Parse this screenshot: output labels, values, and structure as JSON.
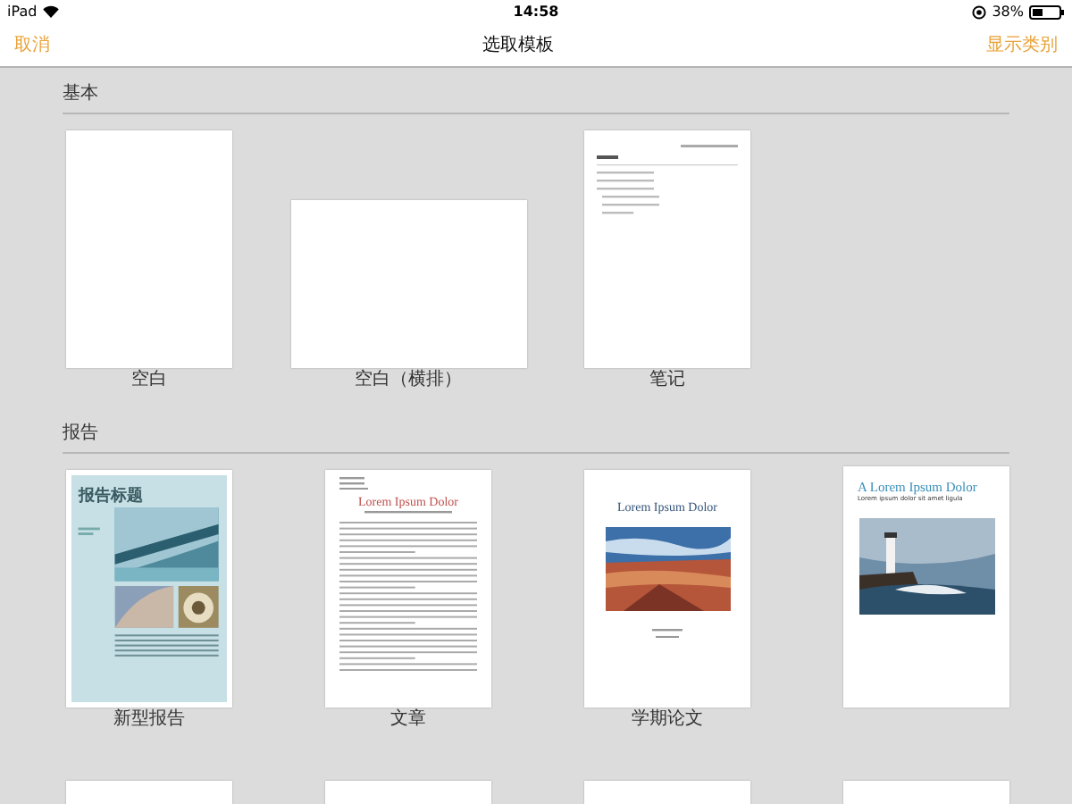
{
  "status_bar": {
    "device": "iPad",
    "time": "14:58",
    "battery": "38%"
  },
  "nav": {
    "cancel": "取消",
    "title": "选取模板",
    "show_categories": "显示类别"
  },
  "sections": [
    {
      "title": "基本",
      "templates": [
        {
          "kind": "blank",
          "name": "空白"
        },
        {
          "kind": "landscape",
          "name": "空白（横排）"
        },
        {
          "kind": "notes",
          "name": "笔记"
        }
      ]
    },
    {
      "title": "报告",
      "templates": [
        {
          "kind": "report",
          "name": "新型报告",
          "heading": "报告标题"
        },
        {
          "kind": "article",
          "name": "文章",
          "heading": "Lorem Ipsum Dolor"
        },
        {
          "kind": "paper",
          "name": "学期论文",
          "heading": "Lorem Ipsum Dolor"
        },
        {
          "heading": "A Lorem Ipsum Dolor",
          "subheading": "Lorem ipsum dolor sit amet ligula"
        },
        {
          "kind": "cut"
        },
        {
          "kind": "cut"
        },
        {
          "kind": "cut"
        },
        {
          "kind": "cut"
        }
      ]
    }
  ]
}
